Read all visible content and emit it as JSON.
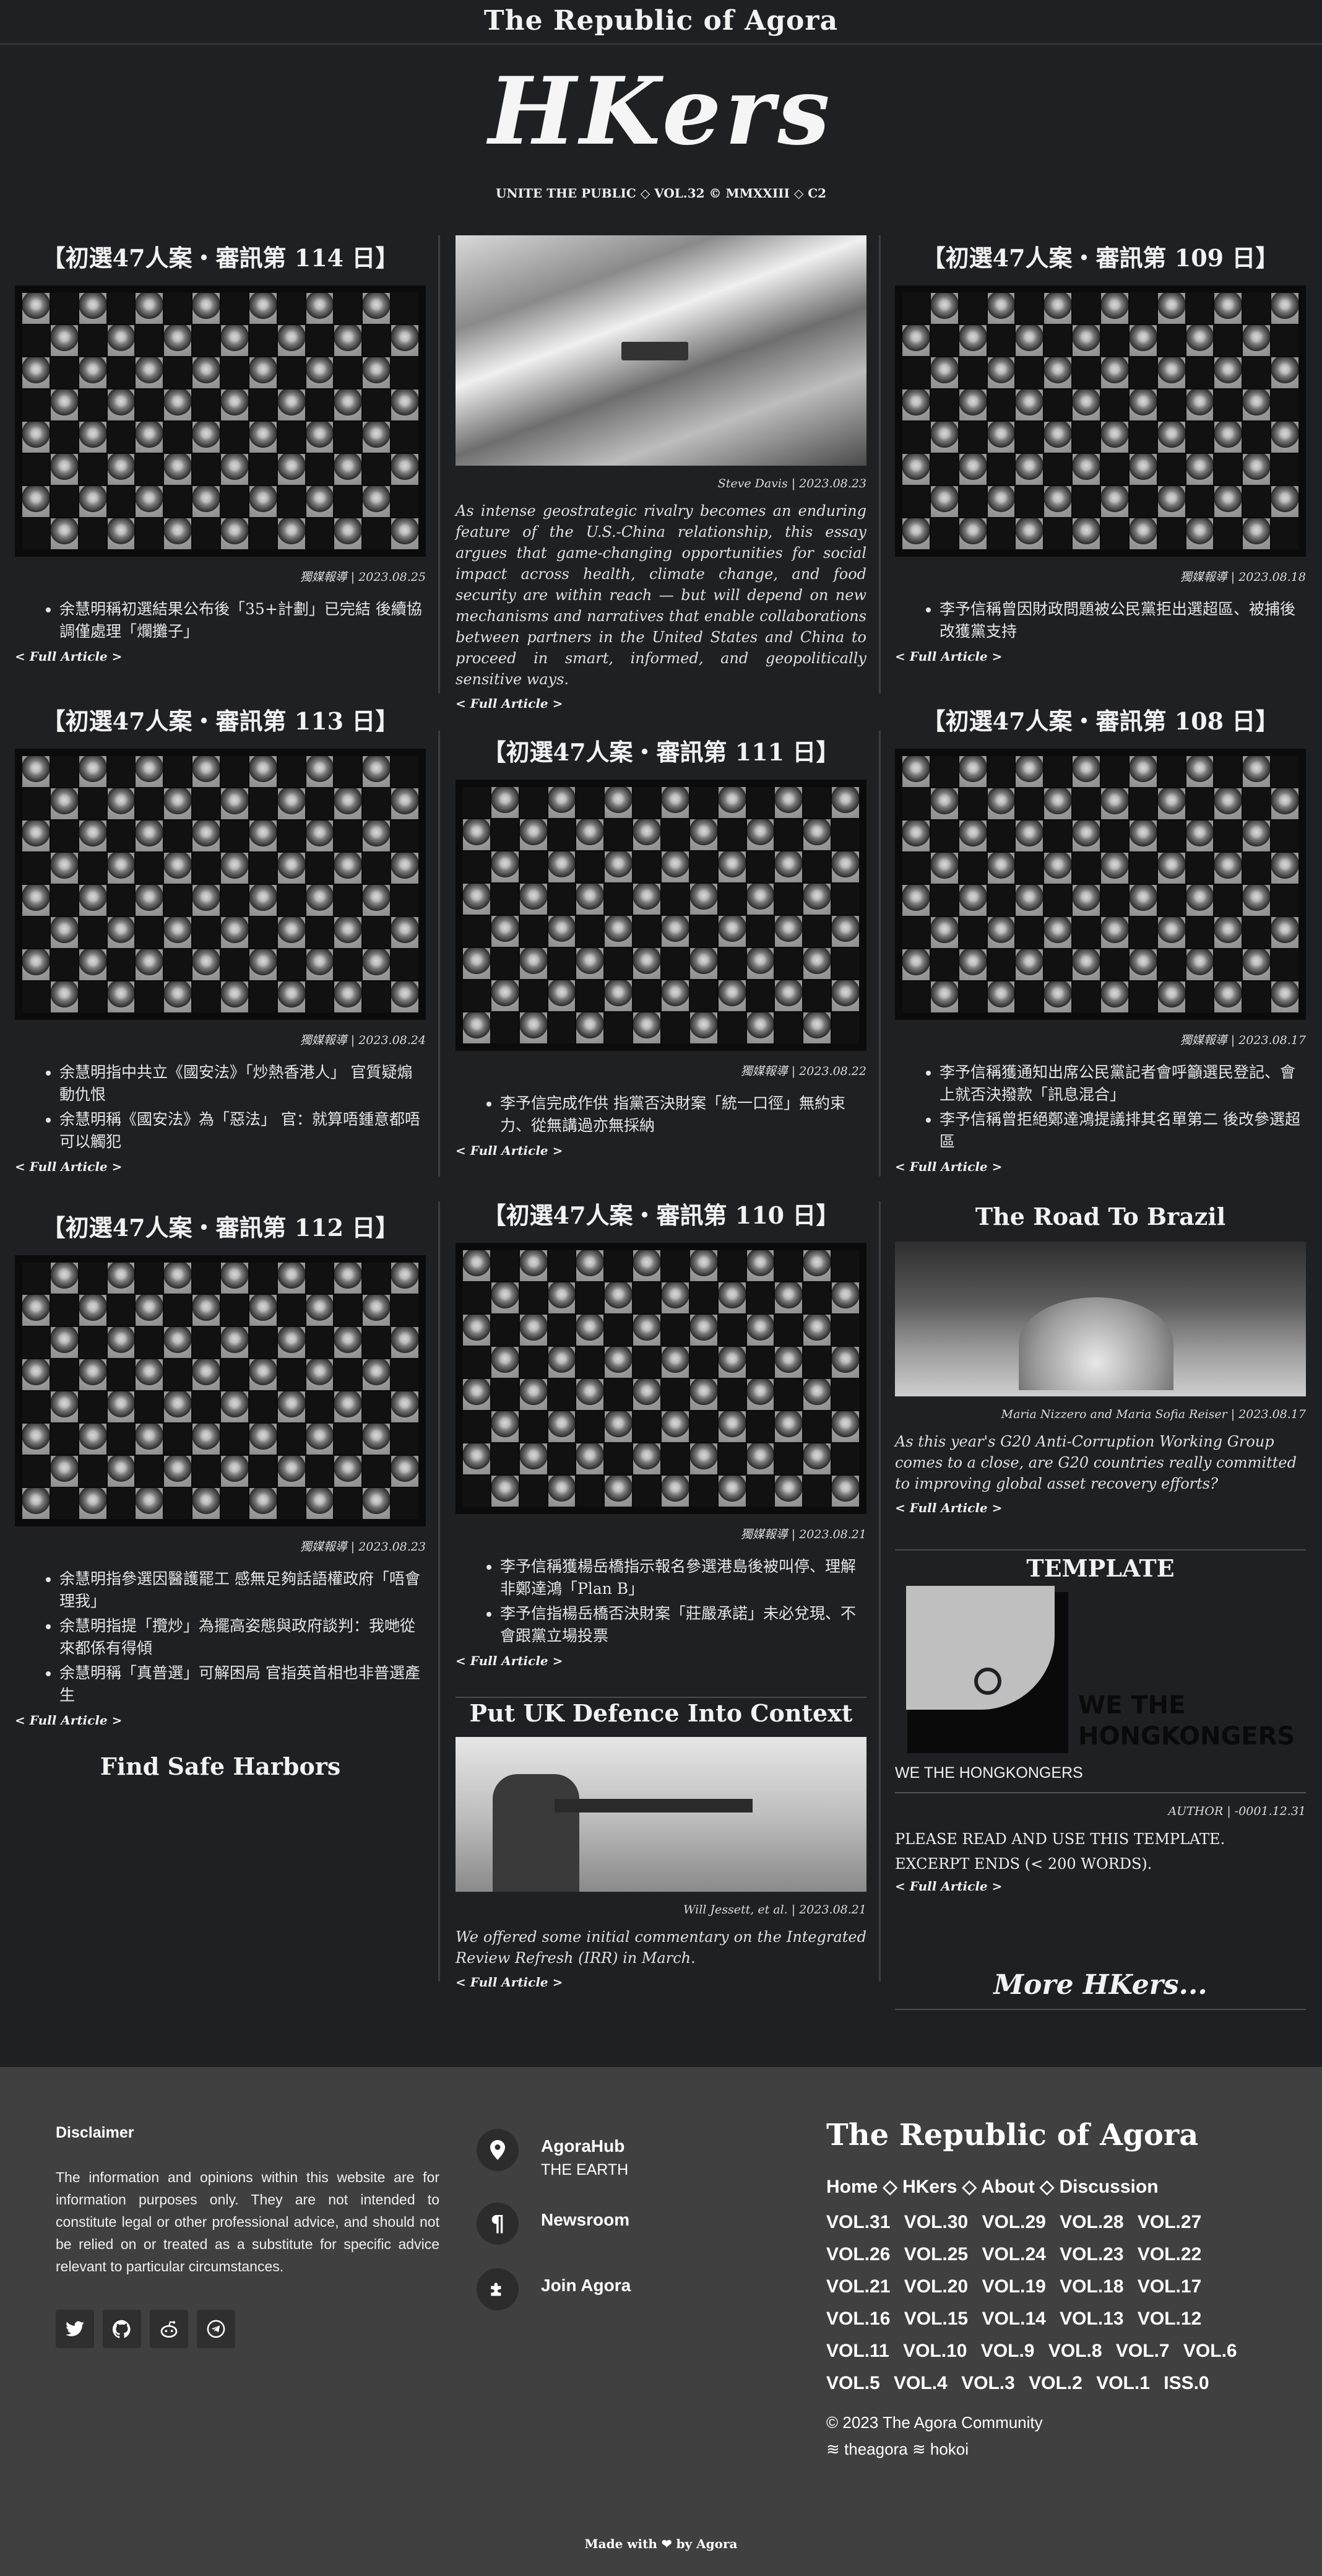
{
  "site": {
    "name": "The Republic of Agora"
  },
  "masthead": {
    "logo": "HKers",
    "tagline": "UNITE THE PUBLIC ◇ VOL.32 © MMXXIII ◇ C2"
  },
  "more_label": "< Full Article >",
  "articles": {
    "a114": {
      "title": "【初選47人案・審訊第 114 日】",
      "byline": "獨媒報導 | 2023.08.25",
      "bullets": [
        "余慧明稱初選結果公布後「35+計劃」已完結 後續協調僅處理「爛攤子」"
      ]
    },
    "steve": {
      "byline": "Steve Davis | 2023.08.23",
      "desc": "As intense geostrategic rivalry becomes an enduring feature of the U.S.-China relationship, this essay argues that game-changing opportunities for social impact across health, climate change, and food security are within reach — but will depend on new mechanisms and narratives that enable collaborations between partners in the United States and China to proceed in smart, informed, and geopolitically sensitive ways."
    },
    "a109": {
      "title": "【初選47人案・審訊第 109 日】",
      "byline": "獨媒報導 | 2023.08.18",
      "bullets": [
        "李予信稱曾因財政問題被公民黨拒出選超區、被捕後改獲黨支持"
      ]
    },
    "a113": {
      "title": "【初選47人案・審訊第 113 日】",
      "byline": "獨媒報導 | 2023.08.24",
      "bullets": [
        "余慧明指中共立《國安法》「炒熱香港人」 官質疑煽動仇恨",
        "余慧明稱《國安法》為「惡法」 官：就算唔鍾意都唔可以觸犯"
      ]
    },
    "a111": {
      "title": "【初選47人案・審訊第 111 日】",
      "byline": "獨媒報導 | 2023.08.22",
      "bullets": [
        "李予信完成作供 指黨否決財案「統一口徑」無約束力、從無講過亦無採納"
      ]
    },
    "a108": {
      "title": "【初選47人案・審訊第 108 日】",
      "byline": "獨媒報導 | 2023.08.17",
      "bullets": [
        "李予信稱獲通知出席公民黨記者會呼籲選民登記、會上就否決撥款「訊息混合」",
        "李予信稱曾拒絕鄭達鴻提議排其名單第二 後改參選超區"
      ]
    },
    "a112": {
      "title": "【初選47人案・審訊第 112 日】",
      "byline": "獨媒報導 | 2023.08.23",
      "bullets": [
        "余慧明指參選因醫護罷工 感無足夠話語權政府「唔會理我」",
        "余慧明指提「攬炒」為擺高姿態與政府談判：我哋從來都係有得傾",
        "余慧明稱「真普選」可解困局 官指英首相也非普選產生"
      ]
    },
    "a110": {
      "title": "【初選47人案・審訊第 110 日】",
      "byline": "獨媒報導 | 2023.08.21",
      "bullets": [
        "李予信稱獲楊岳橋指示報名參選港島後被叫停、理解非鄭達鴻「Plan B」",
        "李予信指楊岳橋否決財案「莊嚴承諾」未必兌現、不會跟黨立場投票"
      ]
    },
    "brazil": {
      "title": "The Road To Brazil",
      "byline": "Maria Nizzero and Maria Sofia Reiser | 2023.08.17",
      "desc": "As this year's G20 Anti-Corruption Working Group comes to a close, are G20 countries really committed to improving global asset recovery efforts?"
    },
    "template": {
      "title": "TEMPLATE",
      "img_text_1": "WE THE",
      "img_text_2": "HONGKONGERS",
      "caption": "WE THE HONGKONGERS",
      "byline": "AUTHOR | -0001.12.31",
      "line1": "PLEASE READ AND USE THIS TEMPLATE.",
      "line2": "EXCERPT ENDS (< 200 WORDS)."
    },
    "safe": {
      "title": "Find Safe Harbors"
    },
    "uk": {
      "title": "Put UK Defence Into Context",
      "byline": "Will Jessett, et al. | 2023.08.21",
      "desc": "We offered some initial commentary on the Integrated Review Refresh (IRR) in March."
    }
  },
  "more_hkers": "More HKers...",
  "footer": {
    "disclaimer_heading": "Disclaimer",
    "disclaimer": "The information and opinions within this website are for information purposes only. They are not intended to constitute legal or other professional advice, and should not be relied on or treated as a substitute for specific advice relevant to particular circumstances.",
    "social_icons": [
      "twitter-icon",
      "github-icon",
      "reddit-icon",
      "telegram-icon"
    ],
    "links": [
      {
        "label": "AgoraHub",
        "sub": "THE EARTH",
        "icon": "map-pin-icon"
      },
      {
        "label": "Newsroom",
        "sub": "",
        "icon": "pilcrow-icon"
      },
      {
        "label": "Join Agora",
        "sub": "",
        "icon": "puzzle-icon"
      }
    ],
    "brand": "The Republic of Agora",
    "nav": "Home ◇ HKers ◇ About ◇ Discussion",
    "vols": [
      "VOL.31",
      "VOL.30",
      "VOL.29",
      "VOL.28",
      "VOL.27",
      "VOL.26",
      "VOL.25",
      "VOL.24",
      "VOL.23",
      "VOL.22",
      "VOL.21",
      "VOL.20",
      "VOL.19",
      "VOL.18",
      "VOL.17",
      "VOL.16",
      "VOL.15",
      "VOL.14",
      "VOL.13",
      "VOL.12",
      "VOL.11",
      "VOL.10",
      "VOL.9",
      "VOL.8",
      "VOL.7",
      "VOL.6",
      "VOL.5",
      "VOL.4",
      "VOL.3",
      "VOL.2",
      "VOL.1",
      "ISS.0"
    ],
    "copyright": "© 2023 The Agora Community",
    "handles": "≋ theagora ≋ hokoi",
    "made": "Made with ❤ by Agora"
  }
}
